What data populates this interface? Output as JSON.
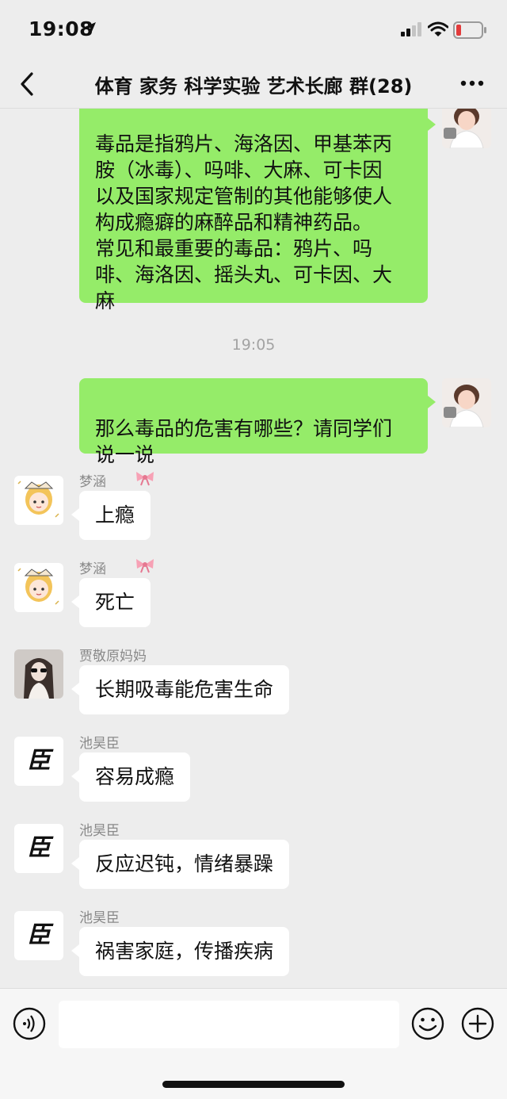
{
  "status_bar": {
    "time": "19:08"
  },
  "nav": {
    "title": "体育 家务 科学实验 艺术长廊 群(28)"
  },
  "messages": [
    {
      "type": "outgoing",
      "text": "毒品是指鸦片、海洛因、甲基苯丙\n胺（冰毒）、吗啡、大麻、可卡因\n以及国家规定管制的其他能够使人\n构成瘾癖的麻醉品和精神药品。\n常见和最重要的毒品：鸦片、吗\n啡、海洛因、摇头丸、可卡因、大\n麻"
    },
    {
      "type": "timestamp",
      "text": "19:05"
    },
    {
      "type": "outgoing",
      "text": "那么毒品的危害有哪些？请同学们\n说一说"
    },
    {
      "type": "incoming",
      "sender": "梦涵",
      "text": "上瘾"
    },
    {
      "type": "incoming",
      "sender": "梦涵",
      "text": "死亡"
    },
    {
      "type": "incoming",
      "sender": "贾敬原妈妈",
      "text": "长期吸毒能危害生命"
    },
    {
      "type": "incoming",
      "sender": "池昊臣",
      "text": "容易成瘾",
      "avatar_text": "臣"
    },
    {
      "type": "incoming",
      "sender": "池昊臣",
      "text": "反应迟钝，情绪暴躁",
      "avatar_text": "臣"
    },
    {
      "type": "incoming",
      "sender": "池昊臣",
      "text": "祸害家庭，传播疾病",
      "avatar_text": "臣"
    }
  ],
  "colors": {
    "outgoing_bubble": "#95ec69",
    "incoming_bubble": "#ffffff",
    "background": "#ededed"
  },
  "icons": [
    "location-arrow-icon",
    "signal-icon",
    "wifi-icon",
    "battery-low-icon",
    "back-chevron-icon",
    "more-dots-icon",
    "voice-icon",
    "emoji-icon",
    "plus-icon",
    "bow-icon"
  ]
}
